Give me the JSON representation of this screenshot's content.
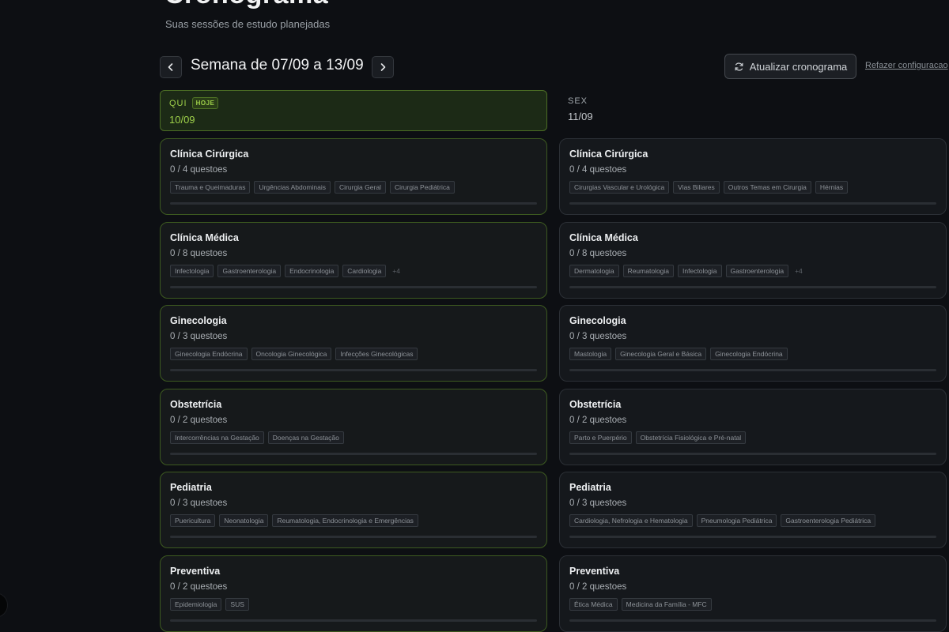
{
  "header": {
    "title": "Cronograma",
    "subtitle": "Suas sessões de estudo planejadas",
    "week_label": "Semana de 07/09 a 13/09",
    "refresh_label": "Atualizar cronograma",
    "redo_label": "Refazer configuracao"
  },
  "colors": {
    "accent": "#9fd14a",
    "today_bg": "#1c2a16",
    "card_border": "#2c3036"
  },
  "days": [
    {
      "dow": "QUI",
      "date": "10/09",
      "badge": "HOJE",
      "sessions": [
        {
          "subject": "Clínica Cirúrgica",
          "count": "0 / 4 questoes",
          "progress": 0,
          "tags": [
            "Trauma e Queimaduras",
            "Urgências Abdominais",
            "Cirurgia Geral",
            "Cirurgia Pediátrica"
          ],
          "more": ""
        },
        {
          "subject": "Clínica Médica",
          "count": "0 / 8 questoes",
          "progress": 0,
          "tags": [
            "Infectologia",
            "Gastroenterologia",
            "Endocrinologia",
            "Cardiologia"
          ],
          "more": "+4"
        },
        {
          "subject": "Ginecologia",
          "count": "0 / 3 questoes",
          "progress": 0,
          "tags": [
            "Ginecologia Endócrina",
            "Oncologia Ginecológica",
            "Infecções Ginecológicas"
          ],
          "more": ""
        },
        {
          "subject": "Obstetrícia",
          "count": "0 / 2 questoes",
          "progress": 0,
          "tags": [
            "Intercorrências na Gestação",
            "Doenças na Gestação"
          ],
          "more": ""
        },
        {
          "subject": "Pediatria",
          "count": "0 / 3 questoes",
          "progress": 0,
          "tags": [
            "Puericultura",
            "Neonatologia",
            "Reumatologia, Endocrinologia e Emergências"
          ],
          "more": ""
        },
        {
          "subject": "Preventiva",
          "count": "0 / 2 questoes",
          "progress": 0,
          "tags": [
            "Epidemiologia",
            "SUS"
          ],
          "more": ""
        }
      ]
    },
    {
      "dow": "SEX",
      "date": "11/09",
      "badge": "",
      "sessions": [
        {
          "subject": "Clínica Cirúrgica",
          "count": "0 / 4 questoes",
          "progress": 0,
          "tags": [
            "Cirurgias Vascular e Urológica",
            "Vias Biliares",
            "Outros Temas em Cirurgia",
            "Hérnias"
          ],
          "more": ""
        },
        {
          "subject": "Clínica Médica",
          "count": "0 / 8 questoes",
          "progress": 0,
          "tags": [
            "Dermatologia",
            "Reumatologia",
            "Infectologia",
            "Gastroenterologia"
          ],
          "more": "+4"
        },
        {
          "subject": "Ginecologia",
          "count": "0 / 3 questoes",
          "progress": 0,
          "tags": [
            "Mastologia",
            "Ginecologia Geral e Básica",
            "Ginecologia Endócrina"
          ],
          "more": ""
        },
        {
          "subject": "Obstetrícia",
          "count": "0 / 2 questoes",
          "progress": 0,
          "tags": [
            "Parto e Puerpério",
            "Obstetrícia Fisiológica e Pré-natal"
          ],
          "more": ""
        },
        {
          "subject": "Pediatria",
          "count": "0 / 3 questoes",
          "progress": 0,
          "tags": [
            "Cardiologia, Nefrologia e Hematologia",
            "Pneumologia Pediátrica",
            "Gastroenterologia Pediátrica"
          ],
          "more": ""
        },
        {
          "subject": "Preventiva",
          "count": "0 / 2 questoes",
          "progress": 0,
          "tags": [
            "Ética Médica",
            "Medicina da Família - MFC"
          ],
          "more": ""
        }
      ]
    }
  ]
}
